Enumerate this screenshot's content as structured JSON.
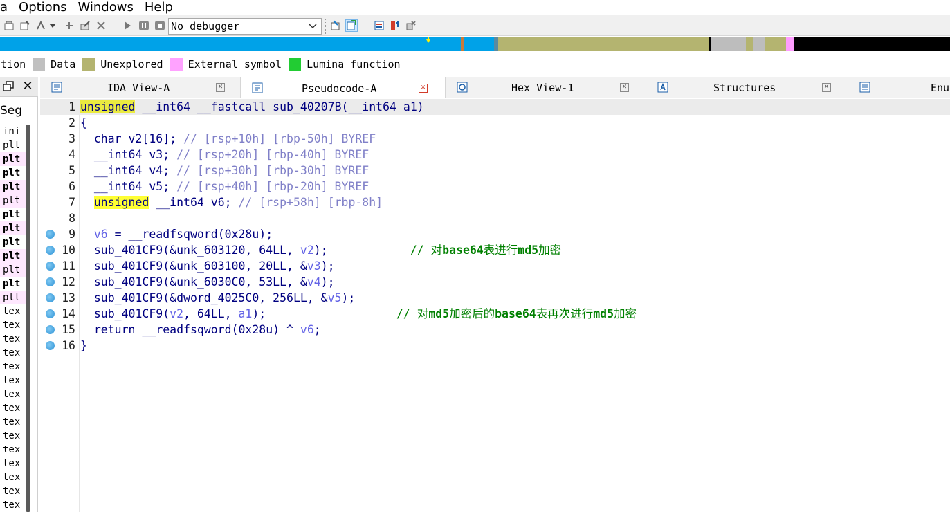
{
  "menu": [
    "a",
    "Options",
    "Windows",
    "Help"
  ],
  "toolbar": {
    "debugger_value": "No debugger",
    "icons": [
      "script-icon",
      "analyze-icon",
      "breakpoint-icon",
      "dropdown-icon",
      "run-plugin-icon",
      "edit-icon",
      "close-icon",
      "start-icon",
      "pause-icon",
      "stop-icon",
      "attach-icon",
      "graph-icon",
      "structures-icon",
      "types-icon",
      "settings-icon"
    ]
  },
  "navband": {
    "colors": {
      "library": "#00a2e8",
      "unexplored": "#b4b470",
      "data": "#bdbdbd",
      "external": "#ff9cff",
      "black": "#000000",
      "code": "#00a2e8"
    }
  },
  "legend": [
    {
      "label": "ction",
      "color": null
    },
    {
      "label": "Data",
      "color": "#c0c0c0"
    },
    {
      "label": "Unexplored",
      "color": "#b4b470"
    },
    {
      "label": "External symbol",
      "color": "#ffa2ff"
    },
    {
      "label": "Lumina function",
      "color": "#22cc33"
    }
  ],
  "left_panel": {
    "title": "Seg",
    "rows": [
      {
        "text": "ini",
        "style": "normal"
      },
      {
        "text": "plt",
        "style": "normal"
      },
      {
        "text": "plt",
        "style": "pink-bold"
      },
      {
        "text": "plt",
        "style": "bold"
      },
      {
        "text": "plt",
        "style": "pink-bold"
      },
      {
        "text": "plt",
        "style": "pink"
      },
      {
        "text": "plt",
        "style": "bold"
      },
      {
        "text": "plt",
        "style": "pink-bold"
      },
      {
        "text": "plt",
        "style": "bold"
      },
      {
        "text": "plt",
        "style": "pink-bold"
      },
      {
        "text": "plt",
        "style": "pink"
      },
      {
        "text": "plt",
        "style": "bold"
      },
      {
        "text": "plt",
        "style": "pink"
      },
      {
        "text": "tex",
        "style": "normal"
      },
      {
        "text": "tex",
        "style": "normal"
      },
      {
        "text": "tex",
        "style": "normal"
      },
      {
        "text": "tex",
        "style": "normal"
      },
      {
        "text": "tex",
        "style": "normal"
      },
      {
        "text": "tex",
        "style": "normal"
      },
      {
        "text": "tex",
        "style": "normal"
      },
      {
        "text": "tex",
        "style": "normal"
      },
      {
        "text": "tex",
        "style": "normal"
      },
      {
        "text": "tex",
        "style": "normal"
      },
      {
        "text": "tex",
        "style": "normal"
      },
      {
        "text": "tex",
        "style": "normal"
      },
      {
        "text": "tex",
        "style": "normal"
      },
      {
        "text": "tex",
        "style": "normal"
      },
      {
        "text": "tex",
        "style": "normal"
      },
      {
        "text": "tex",
        "style": "normal"
      }
    ]
  },
  "tabs": [
    {
      "label": "IDA View-A",
      "active": false
    },
    {
      "label": "Pseudocode-A",
      "active": true
    },
    {
      "label": "Hex View-1",
      "active": false
    },
    {
      "label": "Structures",
      "active": false
    },
    {
      "label": "Enu",
      "active": false
    }
  ],
  "code": {
    "lines": [
      {
        "n": "1",
        "bp": false
      },
      {
        "n": "2",
        "bp": false
      },
      {
        "n": "3",
        "bp": false
      },
      {
        "n": "4",
        "bp": false
      },
      {
        "n": "5",
        "bp": false
      },
      {
        "n": "6",
        "bp": false
      },
      {
        "n": "7",
        "bp": false
      },
      {
        "n": "8",
        "bp": false
      },
      {
        "n": "9",
        "bp": true
      },
      {
        "n": "10",
        "bp": true
      },
      {
        "n": "11",
        "bp": true
      },
      {
        "n": "12",
        "bp": true
      },
      {
        "n": "13",
        "bp": true
      },
      {
        "n": "14",
        "bp": true
      },
      {
        "n": "15",
        "bp": true
      },
      {
        "n": "16",
        "bp": true
      }
    ],
    "t": {
      "l1a": "unsigned",
      "l1b": " __int64 __fastcall sub_40207B(",
      "l1c": "__int64 a1",
      "l1d": ")",
      "l2": "{",
      "l3a": "  char v2[16]; ",
      "l3b": "// [rsp+10h] [rbp-50h] BYREF",
      "l4a": "  __int64 v3; ",
      "l4b": "// [rsp+20h] [rbp-40h] BYREF",
      "l5a": "  __int64 v4; ",
      "l5b": "// [rsp+30h] [rbp-30h] BYREF",
      "l6a": "  __int64 v5; ",
      "l6b": "// [rsp+40h] [rbp-20h] BYREF",
      "l7pre": "  ",
      "l7a": "unsigned",
      "l7b": " __int64 v6; ",
      "l7c": "// [rsp+58h] [rbp-8h]",
      "l8": "",
      "l9a": "  v6",
      "l9b": " = __readfsqword(0x28u);",
      "l10a": "  sub_401CF9(&unk_603120, 64LL, ",
      "l10b": "v2",
      "l10c": ");            ",
      "l10d": "// 对",
      "l10e": "base64",
      "l10f": "表进行",
      "l10g": "md5",
      "l10h": "加密",
      "l11a": "  sub_401CF9(&unk_603100, 20LL, &",
      "l11b": "v3",
      "l11c": ");",
      "l12a": "  sub_401CF9(&unk_6030C0, 53LL, &",
      "l12b": "v4",
      "l12c": ");",
      "l13a": "  sub_401CF9(&dword_4025C0, 256LL, &",
      "l13b": "v5",
      "l13c": ");",
      "l14a": "  sub_401CF9(",
      "l14b": "v2",
      "l14c": ", 64LL, ",
      "l14d": "a1",
      "l14e": ");                   ",
      "l14f": "// 对",
      "l14g": "md5",
      "l14h": "加密后的",
      "l14i": "base64",
      "l14j": "表再次进行",
      "l14k": "md5",
      "l14l": "加密",
      "l15a": "  return __readfsqword(0x28u) ^ ",
      "l15b": "v6",
      "l15c": ";",
      "l16": "}"
    }
  }
}
